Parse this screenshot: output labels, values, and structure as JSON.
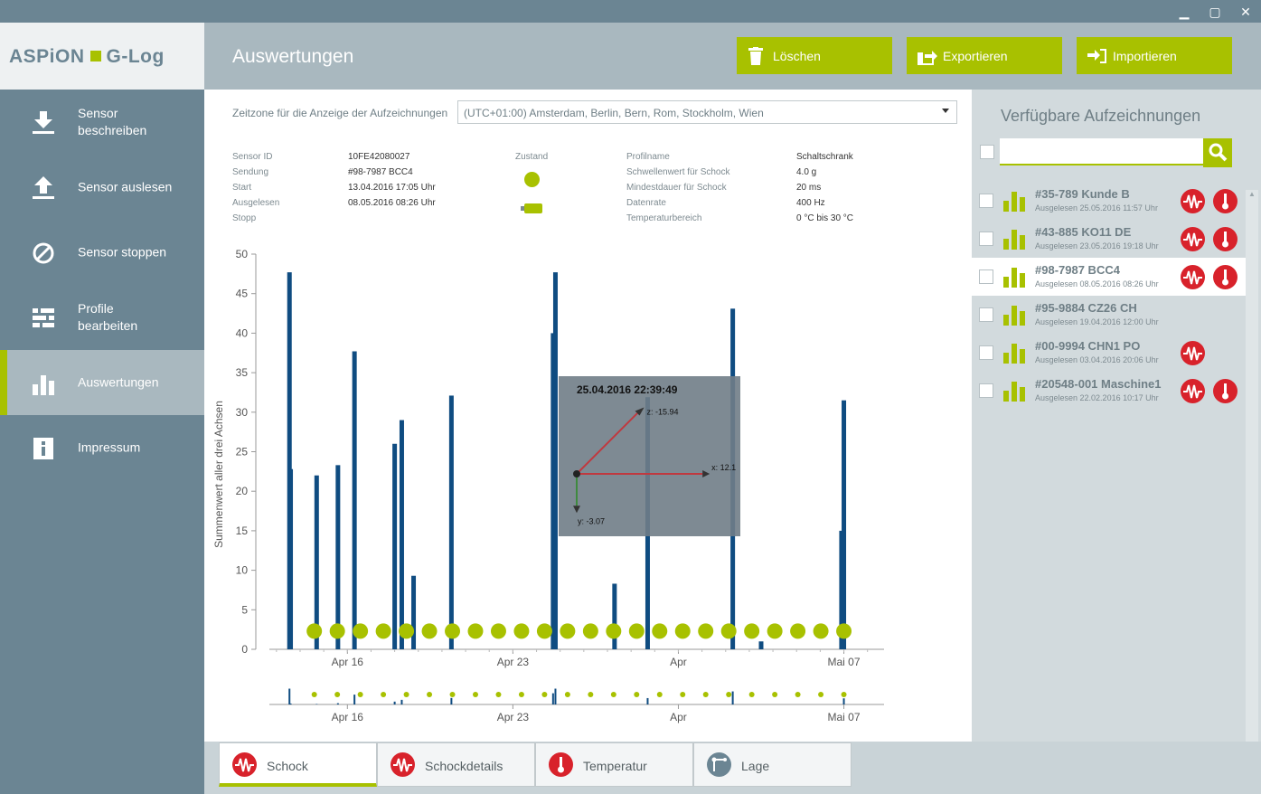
{
  "window": {
    "minimize": "▁",
    "maximize": "▢",
    "close": "✕"
  },
  "app": {
    "logo_left": "ASPiON",
    "logo_right": "G-Log",
    "brand_color": "#a8c100",
    "nav_color": "#6b8593"
  },
  "sidebar": {
    "items": [
      {
        "label": "Sensor\nbeschreiben",
        "icon": "download-icon"
      },
      {
        "label": "Sensor auslesen",
        "icon": "upload-icon"
      },
      {
        "label": "Sensor stoppen",
        "icon": "stop-icon"
      },
      {
        "label": "Profile\nbearbeiten",
        "icon": "sliders-icon"
      },
      {
        "label": "Auswertungen",
        "icon": "bar-chart-icon",
        "active": true
      },
      {
        "label": "Impressum",
        "icon": "info-icon"
      }
    ]
  },
  "header": {
    "title": "Auswertungen",
    "buttons": {
      "delete": "Löschen",
      "export": "Exportieren",
      "import": "Importieren"
    }
  },
  "timezone": {
    "label": "Zeitzone für die Anzeige der Aufzeichnungen",
    "value": "(UTC+01:00) Amsterdam, Berlin, Bern, Rom, Stockholm, Wien"
  },
  "info": {
    "left_labels": [
      "Sensor ID",
      "Sendung",
      "Start",
      "Ausgelesen",
      "Stopp"
    ],
    "left_values": [
      "10FE42080027",
      "#98-7987 BCC4",
      "13.04.2016 17:05 Uhr",
      "08.05.2016 08:26 Uhr",
      ""
    ],
    "status_label": "Zustand",
    "right_labels": [
      "Profilname",
      "Schwellenwert für Schock",
      "Mindestdauer für Schock",
      "Datenrate",
      "Temperaturbereich"
    ],
    "right_values": [
      "Schaltschrank",
      "4.0 g",
      "20 ms",
      "400 Hz",
      "0 °C  bis  30 °C"
    ]
  },
  "chart_data": {
    "type": "bar",
    "ylabel": "Summenwert aller drei Achsen",
    "xlabel": "",
    "ylim": [
      0,
      50
    ],
    "yticks": [
      0,
      5,
      10,
      15,
      20,
      25,
      30,
      35,
      40,
      45,
      50
    ],
    "xlim": [
      13.7,
      39.7
    ],
    "xticks": [
      {
        "x": 17,
        "label": "Apr 16"
      },
      {
        "x": 24,
        "label": "Apr 23"
      },
      {
        "x": 31,
        "label": "Apr"
      },
      {
        "x": 38,
        "label": "Mai 07"
      }
    ],
    "bars": [
      {
        "x": 14.55,
        "y": 47.7
      },
      {
        "x": 14.6,
        "y": 22.8
      },
      {
        "x": 15.7,
        "y": 22.0
      },
      {
        "x": 16.6,
        "y": 23.3
      },
      {
        "x": 17.3,
        "y": 37.7
      },
      {
        "x": 19.0,
        "y": 26.0
      },
      {
        "x": 19.3,
        "y": 29.0
      },
      {
        "x": 19.8,
        "y": 9.3
      },
      {
        "x": 21.4,
        "y": 32.1
      },
      {
        "x": 25.7,
        "y": 40.0
      },
      {
        "x": 25.8,
        "y": 47.7
      },
      {
        "x": 28.3,
        "y": 8.3
      },
      {
        "x": 29.7,
        "y": 31.9
      },
      {
        "x": 33.3,
        "y": 43.1
      },
      {
        "x": 34.5,
        "y": 1.0
      },
      {
        "x": 37.9,
        "y": 15.0
      },
      {
        "x": 38.0,
        "y": 31.5
      }
    ],
    "highlight": {
      "x": 25.75,
      "y": 14.6,
      "color": "#d8222b"
    },
    "markers": {
      "y": 2.3,
      "x_start": 15.6,
      "x_end": 38.0,
      "count": 24,
      "color": "#a8c100"
    },
    "bar_color": "#0f4c81"
  },
  "tooltip": {
    "title": "25.04.2016 22:39:49",
    "x_label": "x: 12.1",
    "y_label": "y: -3.07",
    "z_label": "z: -15.94",
    "x": 12.1,
    "y": -3.07,
    "z": -15.94
  },
  "recordings": {
    "title": "Verfügbare Aufzeichnungen",
    "search_placeholder": "",
    "items": [
      {
        "name": "#35-789 Kunde B",
        "date": "Ausgelesen 25.05.2016 11:57 Uhr",
        "shock": true,
        "temp": true
      },
      {
        "name": "#43-885 KO11 DE",
        "date": "Ausgelesen 23.05.2016 19:18 Uhr",
        "shock": true,
        "temp": true
      },
      {
        "name": "#98-7987 BCC4",
        "date": "Ausgelesen 08.05.2016 08:26 Uhr",
        "shock": true,
        "temp": true,
        "selected": true
      },
      {
        "name": "#95-9884 CZ26 CH",
        "date": "Ausgelesen 19.04.2016 12:00 Uhr",
        "shock": false,
        "temp": false
      },
      {
        "name": "#00-9994 CHN1 PO",
        "date": "Ausgelesen 03.04.2016 20:06 Uhr",
        "shock": true,
        "temp": false
      },
      {
        "name": "#20548-001 Maschine1",
        "date": "Ausgelesen 22.02.2016 10:17 Uhr",
        "shock": true,
        "temp": true
      }
    ]
  },
  "tabs": [
    {
      "label": "Schock",
      "icon": "shock-icon",
      "active": true
    },
    {
      "label": "Schockdetails",
      "icon": "shock-icon"
    },
    {
      "label": "Temperatur",
      "icon": "thermometer-icon"
    },
    {
      "label": "Lage",
      "icon": "orientation-icon"
    }
  ]
}
